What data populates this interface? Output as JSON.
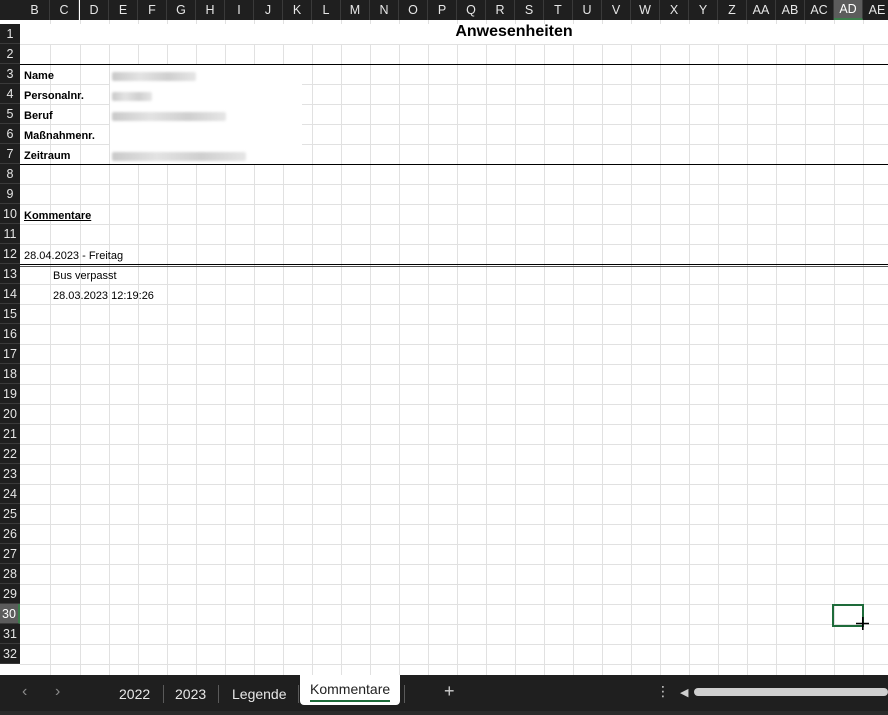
{
  "columns": [
    "B",
    "C",
    "D",
    "E",
    "F",
    "G",
    "H",
    "I",
    "J",
    "K",
    "L",
    "M",
    "N",
    "O",
    "P",
    "Q",
    "R",
    "S",
    "T",
    "U",
    "V",
    "W",
    "X",
    "Y",
    "Z",
    "AA",
    "AB",
    "AC",
    "AD",
    "AE"
  ],
  "rows": [
    "1",
    "2",
    "3",
    "4",
    "5",
    "6",
    "7",
    "8",
    "9",
    "10",
    "11",
    "12",
    "13",
    "14",
    "15",
    "16",
    "17",
    "18",
    "19",
    "20",
    "21",
    "22",
    "23",
    "24",
    "25",
    "26",
    "27",
    "28",
    "29",
    "30",
    "31",
    "32"
  ],
  "selected_column": "AD",
  "selected_row": "30",
  "sheet": {
    "title": "Anwesenheiten",
    "labels": {
      "name": "Name",
      "personalnr": "Personalnr.",
      "beruf": "Beruf",
      "massnahmenr": "Maßnahmenr.",
      "zeitraum": "Zeitraum"
    },
    "comments_heading": "Kommentare",
    "date_entry": "28.04.2023 - Freitag",
    "comment_text": "Bus verpasst",
    "comment_timestamp": "28.03.2023 12:19:26"
  },
  "tabs": {
    "items": [
      "2022",
      "2023",
      "Legende",
      "Kommentare"
    ],
    "active": "Kommentare",
    "add_icon": "plus-icon",
    "prev_icon": "chevron-left-icon",
    "next_icon": "chevron-right-icon",
    "more_icon": "vertical-dots-icon"
  },
  "colors": {
    "header_bg": "#1f1f1f",
    "selection_accent": "#1e6b3a",
    "gridline": "#e1e1e1"
  }
}
